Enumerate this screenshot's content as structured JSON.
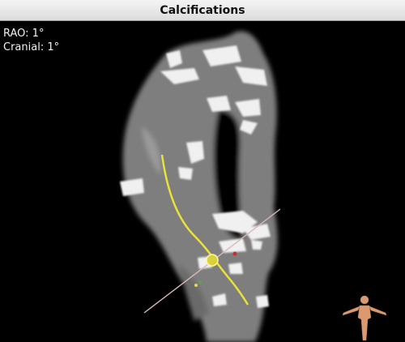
{
  "window": {
    "title": "Calcifications"
  },
  "overlay": {
    "rao": "RAO: 1°",
    "cranial": "Cranial: 1°"
  },
  "icons": {
    "orientation": "human-figure-orientation-icon"
  },
  "colors": {
    "centerline": "#e8e23a",
    "background": "#000000",
    "titlebar": "#e6e6e6"
  }
}
